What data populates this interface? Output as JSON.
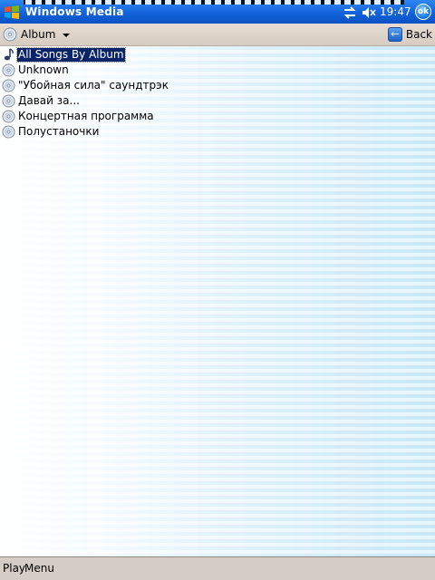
{
  "titlebar": {
    "title": "Windows Media",
    "time": "19:47",
    "ok_label": "ok",
    "icons": [
      "start-icon",
      "sync-icon",
      "volume-icon"
    ]
  },
  "toolbar": {
    "view_label": "Album",
    "back_label": "Back"
  },
  "list": {
    "items": [
      {
        "label": "All Songs By Album",
        "icon": "music-note-icon",
        "selected": true
      },
      {
        "label": "Unknown",
        "icon": "cd-icon"
      },
      {
        "label": "\"Убойная сила\" саундтрэк",
        "icon": "cd-icon"
      },
      {
        "label": "Давай за...",
        "icon": "cd-icon"
      },
      {
        "label": "Концертная программа",
        "icon": "cd-icon"
      },
      {
        "label": "Полустаночки",
        "icon": "cd-icon"
      }
    ]
  },
  "menubar": {
    "left_label": "Play",
    "right_label": "Menu"
  },
  "colors": {
    "titlebar": "#1060d8",
    "selection": "#0a246a",
    "toolbar": "#e0d6cc"
  }
}
